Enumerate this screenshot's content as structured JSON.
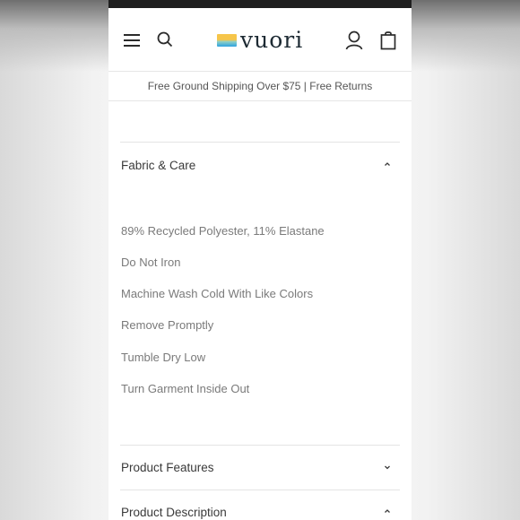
{
  "header": {
    "logo_text": "vuori",
    "icons": [
      "menu-icon",
      "search-icon",
      "account-icon",
      "bag-icon"
    ]
  },
  "promo": {
    "text": "Free Ground Shipping Over $75 | Free Returns"
  },
  "accordion": {
    "fabric_care": {
      "title": "Fabric & Care",
      "expanded": true,
      "items": [
        "89% Recycled Polyester, 11% Elastane",
        "Do Not Iron",
        "Machine Wash Cold With Like Colors",
        "Remove Promptly",
        "Tumble Dry Low",
        "Turn Garment Inside Out"
      ]
    },
    "product_features": {
      "title": "Product Features",
      "expanded": false
    },
    "product_description": {
      "title": "Product Description",
      "expanded": true
    }
  },
  "colors": {
    "text_dark": "#3a3a3a",
    "text_muted": "#7a7a7a",
    "divider": "#e4e4e4",
    "status_bar": "#1f1f1f"
  }
}
